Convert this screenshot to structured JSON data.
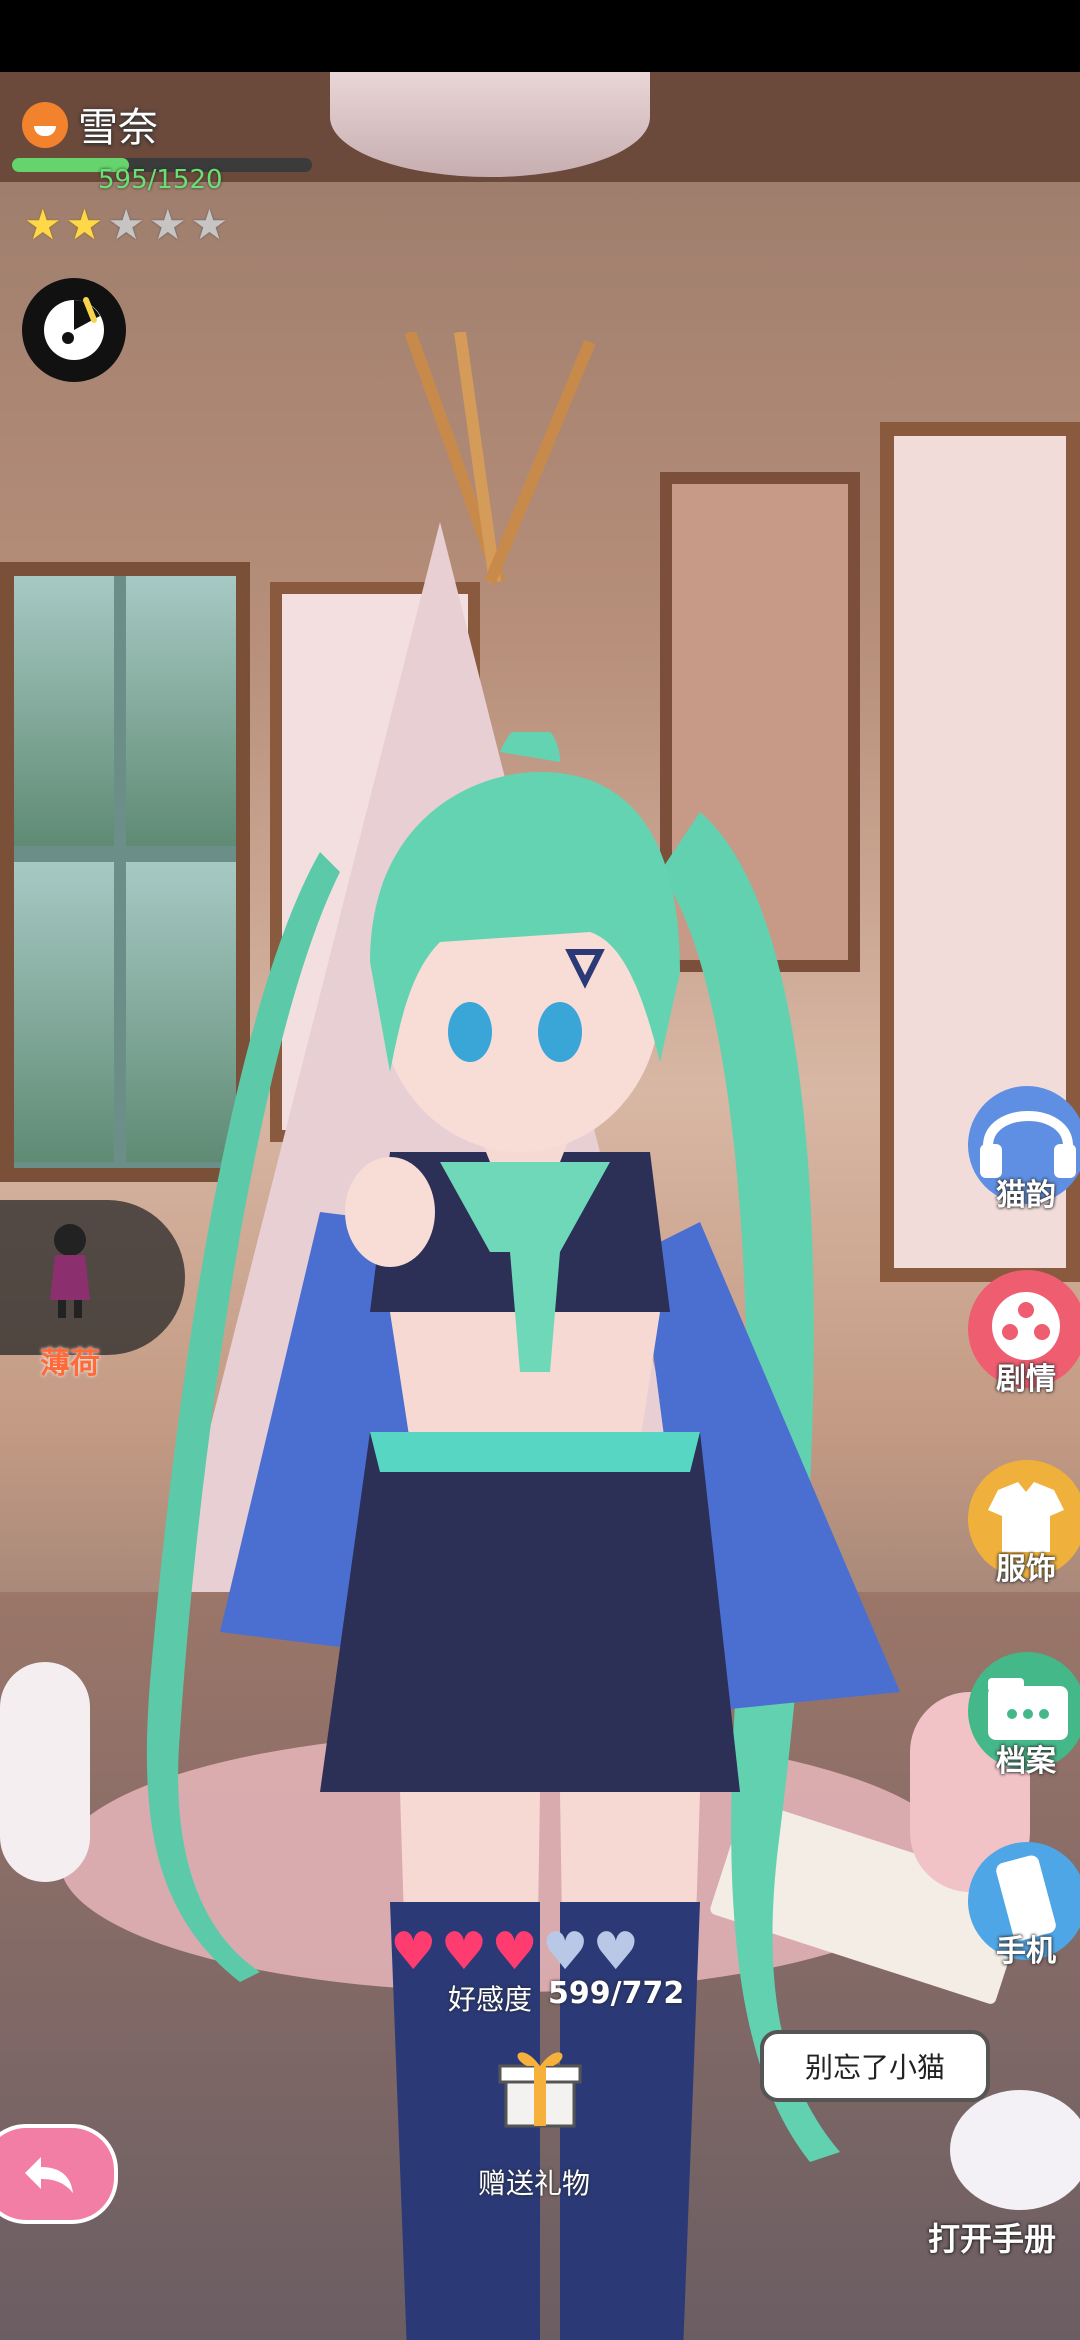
{
  "character": {
    "name": "雪奈",
    "exp_text": "595/1520",
    "exp_fraction": 0.39,
    "stars_total": 5,
    "stars_filled": 2
  },
  "companion": {
    "label": "薄荷"
  },
  "right_menu": [
    {
      "label": "猫韵",
      "icon": "headphones-icon",
      "color": "#5f8fe3"
    },
    {
      "label": "剧情",
      "icon": "film-reel-icon",
      "color": "#ef5d70"
    },
    {
      "label": "服饰",
      "icon": "clothes-icon",
      "color": "#f0b13c"
    },
    {
      "label": "档案",
      "icon": "folder-icon",
      "color": "#44b889"
    },
    {
      "label": "手机",
      "icon": "phone-icon",
      "color": "#4fa6e7"
    }
  ],
  "affection": {
    "label": "好感度",
    "value_text": "599/772",
    "hearts_total": 5,
    "hearts_full": 3
  },
  "gift": {
    "label": "赠送礼物"
  },
  "reminder": {
    "text": "别忘了小猫"
  },
  "handbook": {
    "label": "打开手册"
  },
  "colors": {
    "exp_bar": "#66d46c",
    "heart": "#ff3c70",
    "back_button": "#f37ea5"
  }
}
